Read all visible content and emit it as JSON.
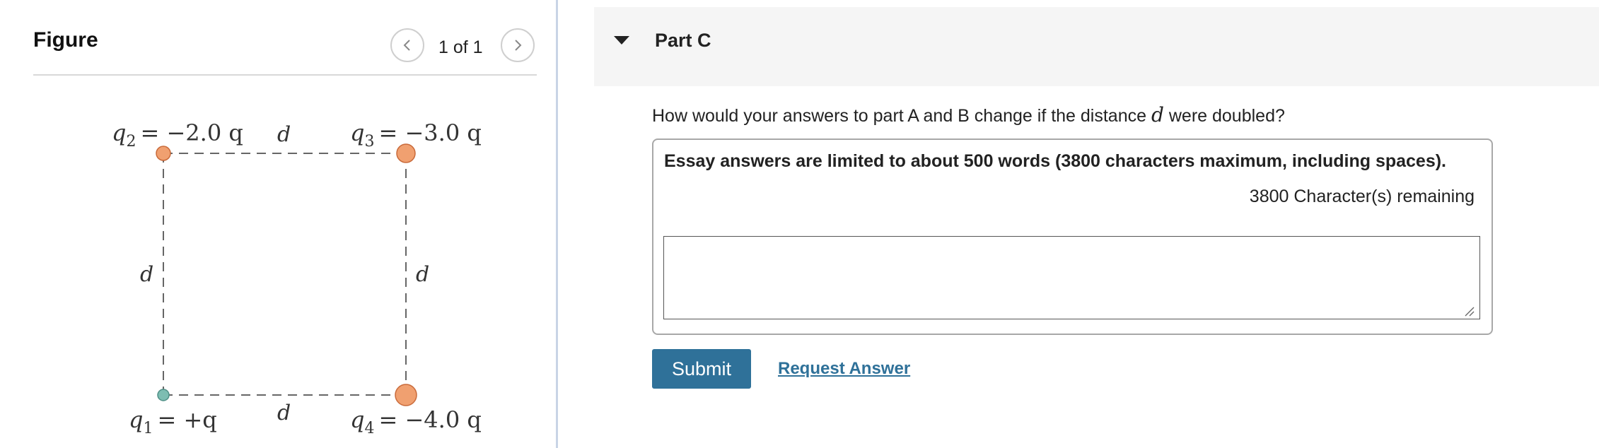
{
  "figure": {
    "title": "Figure",
    "page_indicator": "1 of 1",
    "prev_icon": "chevron-left-icon",
    "next_icon": "chevron-right-icon",
    "charges": {
      "q1": {
        "symbol": "q",
        "sub": "1",
        "value": "= +q",
        "color": "#7dbdb2"
      },
      "q2": {
        "symbol": "q",
        "sub": "2",
        "value": "= −2.0 q",
        "color": "#f0a070"
      },
      "q3": {
        "symbol": "q",
        "sub": "3",
        "value": "= −3.0 q",
        "color": "#f0a070"
      },
      "q4": {
        "symbol": "q",
        "sub": "4",
        "value": "= −4.0 q",
        "color": "#f0a070"
      }
    },
    "side_label": "d"
  },
  "part": {
    "title": "Part C",
    "question_before": "How would your answers to part A and B change if the distance ",
    "question_var": "d",
    "question_after": " were doubled?",
    "limit_text": "Essay answers are limited to about 500 words (3800 characters maximum, including spaces).",
    "remaining_text": "3800 Character(s) remaining",
    "answer_value": "",
    "submit_label": "Submit",
    "request_label": "Request Answer"
  },
  "colors": {
    "accent": "#2f7199",
    "header_bg": "#f5f5f5",
    "divider": "#c8d4e6"
  }
}
